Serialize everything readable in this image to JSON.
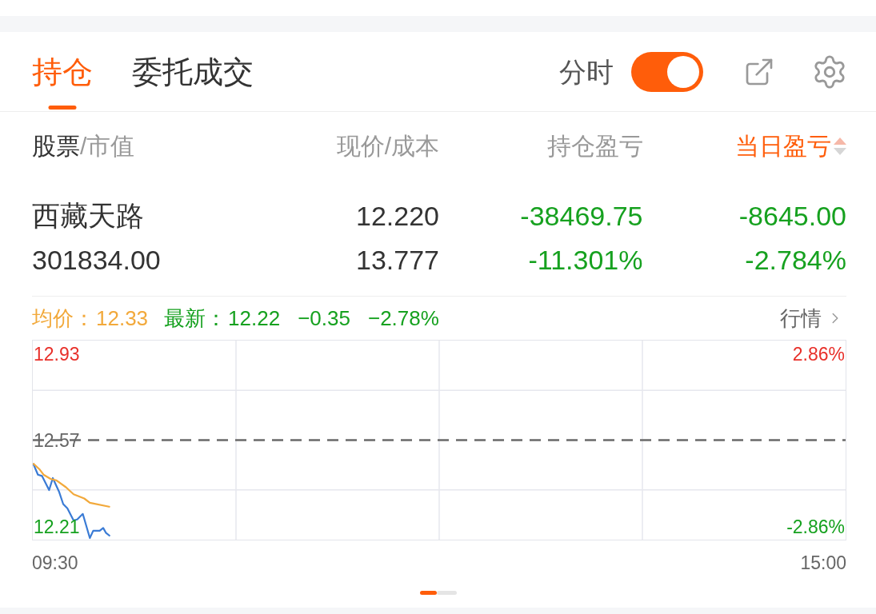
{
  "tabs": [
    {
      "label": "持仓",
      "selected": true
    },
    {
      "label": "委托成交",
      "selected": false
    }
  ],
  "time_share_toggle": {
    "label": "分时",
    "on": true
  },
  "columns": [
    {
      "label": "股票",
      "sublabel": "/市值",
      "sorted": false
    },
    {
      "label": "现价/成本",
      "sorted": false
    },
    {
      "label": "持仓盈亏",
      "sorted": false
    },
    {
      "label": "当日盈亏",
      "sorted": true
    }
  ],
  "holdings": [
    {
      "name": "西藏天路",
      "market_value": "301834.00",
      "price": "12.220",
      "cost": "13.777",
      "position_pnl": "-38469.75",
      "position_pnl_pct": "-11.301%",
      "day_pnl": "-8645.00",
      "day_pnl_pct": "-2.784%",
      "falling": true
    }
  ],
  "quote_bar": {
    "avg_label": "均价：",
    "avg": "12.33",
    "latest_label": "最新：",
    "latest": "12.22",
    "change": "−0.35",
    "change_pct": "−2.78%",
    "falling": true,
    "link": "行情"
  },
  "chart": {
    "price_labels": [
      "12.93",
      "12.57",
      "12.21"
    ],
    "percent_labels": [
      "2.86%",
      "-2.86%"
    ],
    "time_labels": [
      "09:30",
      "15:00"
    ]
  },
  "page_indicator": [
    {
      "selected": true
    },
    {
      "selected": false
    }
  ]
}
